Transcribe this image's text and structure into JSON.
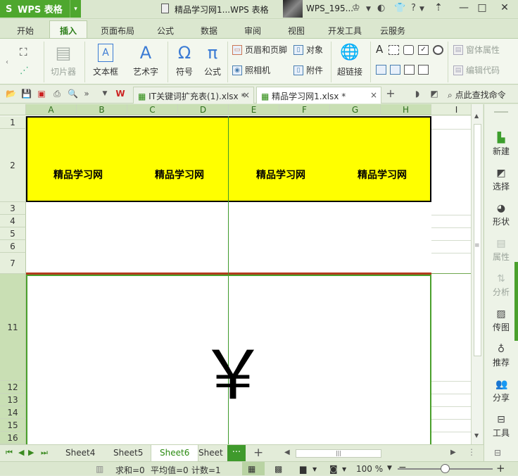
{
  "app": {
    "name": "WPS 表格",
    "document_title": "精品学习网1...WPS 表格",
    "user_name": "WPS_195...",
    "menu_arrow": "▾"
  },
  "window_buttons": {
    "restore_up": "⇡",
    "minimize": "—",
    "maximize": "□",
    "close": "✕"
  },
  "ribbon_tabs": [
    "开始",
    "插入",
    "页面布局",
    "公式",
    "数据",
    "审阅",
    "视图",
    "开发工具",
    "云服务"
  ],
  "active_tab": "插入",
  "ribbon": {
    "screenshot": "切片器",
    "textbox": "文本框",
    "wordart": "艺术字",
    "symbol": "符号",
    "formula": "公式",
    "header_footer": "页眉和页脚",
    "object": "对象",
    "camera": "照相机",
    "attachment": "附件",
    "hyperlink": "超链接",
    "window_props": "窗体属性",
    "edit_code": "编辑代码",
    "textbox_glyph": "A",
    "wordart_glyph": "A",
    "symbol_glyph": "Ω",
    "formula_glyph": "π"
  },
  "doc_tabs": [
    {
      "label": "IT关键词扩充表(1).xlsx *",
      "active": false
    },
    {
      "label": "精品学习网1.xlsx *",
      "active": true
    }
  ],
  "search_command": "点此查找命令",
  "columns": [
    "A",
    "B",
    "C",
    "D",
    "E",
    "F",
    "G",
    "H",
    "I"
  ],
  "rows": [
    "1",
    "2",
    "3",
    "4",
    "5",
    "6",
    "7",
    "11",
    "12",
    "13",
    "14",
    "15",
    "16"
  ],
  "banner_texts": [
    "精品学习网",
    "精品学习网",
    "精品学习网",
    "精品学习网"
  ],
  "yen_symbol": "￥",
  "task_pane": [
    "新建",
    "选择",
    "形状",
    "属性",
    "分析",
    "传图",
    "推荐",
    "分享",
    "工具"
  ],
  "sheet_tabs": [
    "Sheet4",
    "Sheet5",
    "Sheet6",
    "Sheet"
  ],
  "active_sheet": "Sheet6",
  "sheet_more": "···",
  "sheet_add": "+",
  "status": {
    "sum": "求和=0",
    "average": "平均值=0",
    "count": "计数=1",
    "zoom": "100 %"
  }
}
